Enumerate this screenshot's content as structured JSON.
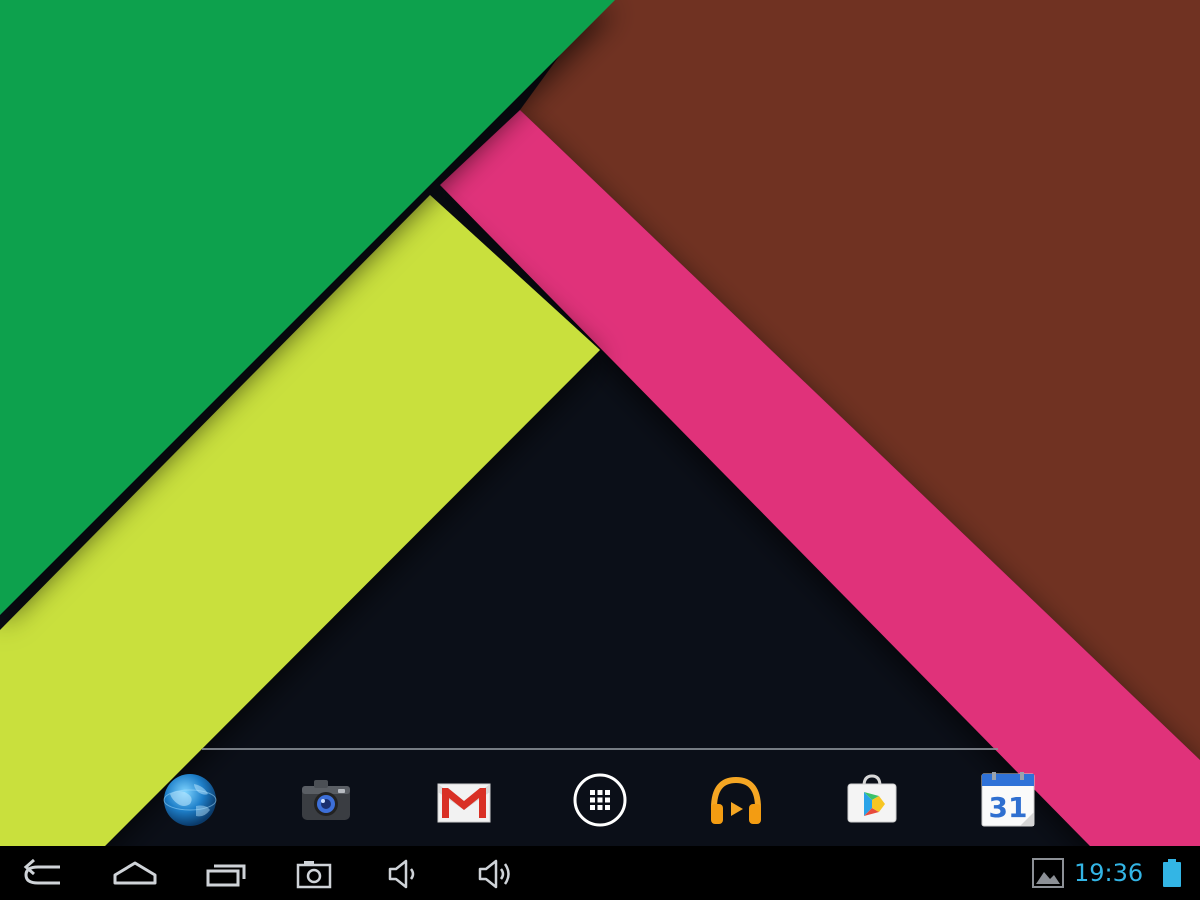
{
  "wallpaper": {
    "colors": {
      "green": "#0aa14e",
      "lime": "#c9e03c",
      "pink": "#e0307a",
      "brown": "#6f3124",
      "dark": "#0b0f18"
    }
  },
  "dock": {
    "apps": [
      {
        "name": "browser",
        "icon": "globe-icon"
      },
      {
        "name": "camera",
        "icon": "camera-icon"
      },
      {
        "name": "gmail",
        "icon": "gmail-icon"
      },
      {
        "name": "all-apps",
        "icon": "app-drawer-icon"
      },
      {
        "name": "play-music",
        "icon": "headphones-icon"
      },
      {
        "name": "play-store",
        "icon": "play-store-icon"
      },
      {
        "name": "calendar",
        "icon": "calendar-icon",
        "label": "31"
      }
    ]
  },
  "system_bar": {
    "nav": [
      {
        "name": "back",
        "icon": "back-icon"
      },
      {
        "name": "home",
        "icon": "home-icon"
      },
      {
        "name": "recent-apps",
        "icon": "recent-apps-icon"
      },
      {
        "name": "screenshot",
        "icon": "screenshot-icon"
      },
      {
        "name": "volume-down",
        "icon": "volume-down-icon"
      },
      {
        "name": "volume-up",
        "icon": "volume-up-icon"
      }
    ],
    "clock": "19:36",
    "clock_color": "#33b5e5",
    "notification_icon": "gallery-notification-icon",
    "battery_icon": "battery-icon"
  }
}
